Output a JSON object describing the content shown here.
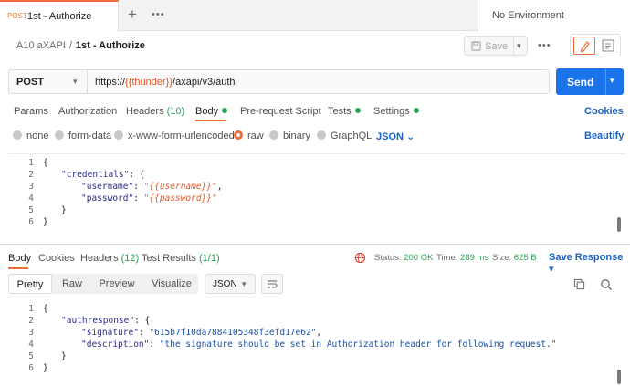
{
  "tab": {
    "method": "POST",
    "name": "1st - Authorize"
  },
  "environment": {
    "label": "No Environment"
  },
  "breadcrumb": {
    "collection": "A10 aXAPI",
    "separator": "/",
    "request": "1st - Authorize"
  },
  "toolbar": {
    "save_label": "Save"
  },
  "request": {
    "method": "POST",
    "url_prefix": "https://",
    "url_variable": "{{thunder}}",
    "url_suffix": "/axapi/v3/auth",
    "send_label": "Send"
  },
  "request_tabs": {
    "params": "Params",
    "authorization": "Authorization",
    "headers": "Headers",
    "headers_count": "(10)",
    "body": "Body",
    "prerequest": "Pre-request Script",
    "tests": "Tests",
    "settings": "Settings",
    "cookies": "Cookies"
  },
  "body_types": {
    "none": "none",
    "form_data": "form-data",
    "urlencoded": "x-www-form-urlencoded",
    "raw": "raw",
    "binary": "binary",
    "graphql": "GraphQL",
    "format": "JSON",
    "beautify": "Beautify"
  },
  "request_body": {
    "lines": [
      "1",
      "2",
      "3",
      "4",
      "5",
      "6"
    ],
    "l1": "{",
    "l2_key": "\"credentials\"",
    "l2_rest": ": {",
    "l3_key": "\"username\"",
    "l3_colon": ": ",
    "l3_val": "\"{{username}}\"",
    "l3_end": ",",
    "l4_key": "\"password\"",
    "l4_colon": ": ",
    "l4_val": "\"{{password}}\"",
    "l5": "}",
    "l6": "}"
  },
  "response_tabs": {
    "body": "Body",
    "cookies": "Cookies",
    "headers": "Headers",
    "headers_count": "(12)",
    "tests": "Test Results",
    "tests_count": "(1/1)"
  },
  "response_meta": {
    "status_label": "Status:",
    "status_value": "200 OK",
    "time_label": "Time:",
    "time_value": "289 ms",
    "size_label": "Size:",
    "size_value": "625 B",
    "save_response": "Save Response"
  },
  "response_view": {
    "pretty": "Pretty",
    "raw": "Raw",
    "preview": "Preview",
    "visualize": "Visualize",
    "format": "JSON"
  },
  "response_body": {
    "lines": [
      "1",
      "2",
      "3",
      "4",
      "5",
      "6"
    ],
    "l1": "{",
    "l2_key": "\"authresponse\"",
    "l2_rest": ": {",
    "l3_key": "\"signature\"",
    "l3_colon": ": ",
    "l3_val": "\"615b7f10da7884105348f3efd17e62\"",
    "l3_end": ",",
    "l4_key": "\"description\"",
    "l4_colon": ": ",
    "l4_val": "\"the signature should be set in Authorization header for following request.\"",
    "l5": "}",
    "l6": "}"
  },
  "colors": {
    "accent": "#f26b3a",
    "send": "#1a73e8",
    "link": "#1a62c4",
    "success": "#2aa856"
  }
}
